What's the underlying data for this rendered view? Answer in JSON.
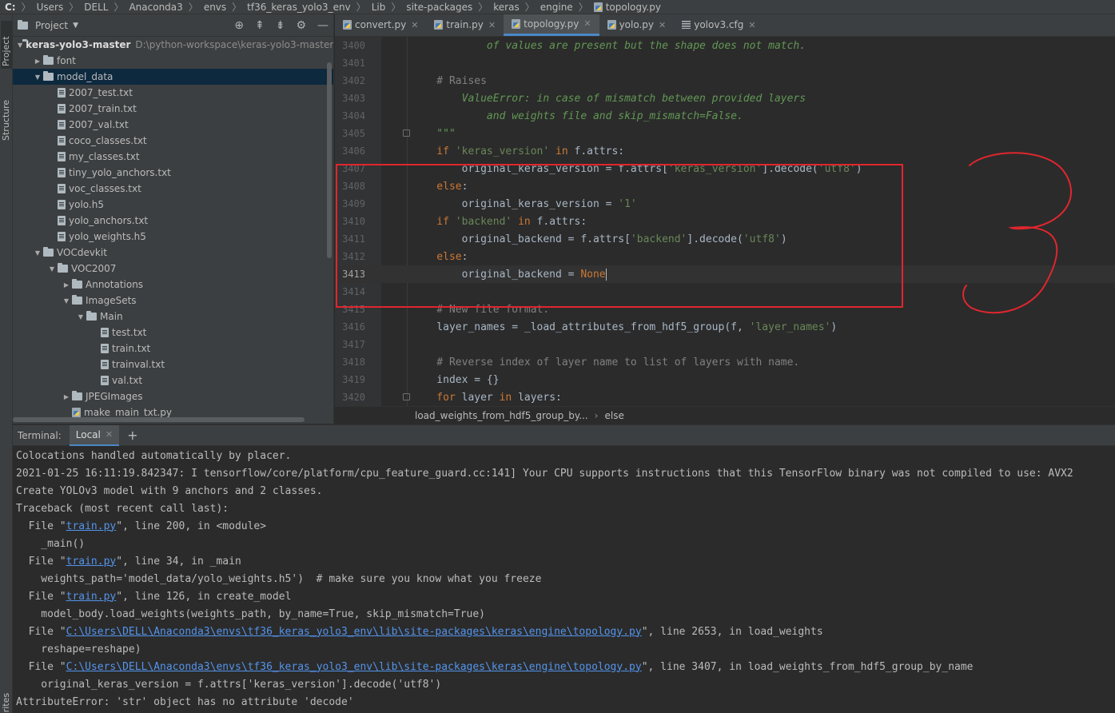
{
  "breadcrumb": [
    "C:",
    "Users",
    "DELL",
    "Anaconda3",
    "envs",
    "tf36_keras_yolo3_env",
    "Lib",
    "site-packages",
    "keras",
    "engine",
    "topology.py"
  ],
  "left_stripe": {
    "project": "Project",
    "structure": "Structure",
    "favorites": "orites"
  },
  "project": {
    "title": "Project",
    "tree": [
      {
        "label": "keras-yolo3-master",
        "path": "D:\\python-workspace\\keras-yolo3-master",
        "depth": 0,
        "arrow": "down",
        "icon": "folder",
        "bold": true
      },
      {
        "label": "font",
        "depth": 1,
        "arrow": "right",
        "icon": "folder"
      },
      {
        "label": "model_data",
        "depth": 1,
        "arrow": "down",
        "icon": "folder",
        "selected": true
      },
      {
        "label": "2007_test.txt",
        "depth": 2,
        "arrow": "none",
        "icon": "txt"
      },
      {
        "label": "2007_train.txt",
        "depth": 2,
        "arrow": "none",
        "icon": "txt"
      },
      {
        "label": "2007_val.txt",
        "depth": 2,
        "arrow": "none",
        "icon": "txt"
      },
      {
        "label": "coco_classes.txt",
        "depth": 2,
        "arrow": "none",
        "icon": "txt"
      },
      {
        "label": "my_classes.txt",
        "depth": 2,
        "arrow": "none",
        "icon": "txt"
      },
      {
        "label": "tiny_yolo_anchors.txt",
        "depth": 2,
        "arrow": "none",
        "icon": "txt"
      },
      {
        "label": "voc_classes.txt",
        "depth": 2,
        "arrow": "none",
        "icon": "txt"
      },
      {
        "label": "yolo.h5",
        "depth": 2,
        "arrow": "none",
        "icon": "txt"
      },
      {
        "label": "yolo_anchors.txt",
        "depth": 2,
        "arrow": "none",
        "icon": "txt"
      },
      {
        "label": "yolo_weights.h5",
        "depth": 2,
        "arrow": "none",
        "icon": "txt"
      },
      {
        "label": "VOCdevkit",
        "depth": 1,
        "arrow": "down",
        "icon": "folder"
      },
      {
        "label": "VOC2007",
        "depth": 2,
        "arrow": "down",
        "icon": "folder"
      },
      {
        "label": "Annotations",
        "depth": 3,
        "arrow": "right",
        "icon": "folder"
      },
      {
        "label": "ImageSets",
        "depth": 3,
        "arrow": "down",
        "icon": "folder"
      },
      {
        "label": "Main",
        "depth": 4,
        "arrow": "down",
        "icon": "folder"
      },
      {
        "label": "test.txt",
        "depth": 5,
        "arrow": "none",
        "icon": "txt"
      },
      {
        "label": "train.txt",
        "depth": 5,
        "arrow": "none",
        "icon": "txt"
      },
      {
        "label": "trainval.txt",
        "depth": 5,
        "arrow": "none",
        "icon": "txt"
      },
      {
        "label": "val.txt",
        "depth": 5,
        "arrow": "none",
        "icon": "txt"
      },
      {
        "label": "JPEGImages",
        "depth": 3,
        "arrow": "right",
        "icon": "folder"
      },
      {
        "label": "make_main_txt.py",
        "depth": 3,
        "arrow": "none",
        "icon": "py"
      }
    ]
  },
  "editor": {
    "tabs": [
      {
        "label": "convert.py",
        "icon": "py",
        "active": false
      },
      {
        "label": "train.py",
        "icon": "py",
        "active": false
      },
      {
        "label": "topology.py",
        "icon": "py",
        "active": true
      },
      {
        "label": "yolo.py",
        "icon": "py",
        "active": false
      },
      {
        "label": "yolov3.cfg",
        "icon": "cfg",
        "active": false
      }
    ],
    "lines": [
      {
        "n": "3400",
        "segs": [
          [
            "doc",
            "            of values are present but the shape does not match."
          ]
        ]
      },
      {
        "n": "3401",
        "segs": []
      },
      {
        "n": "3402",
        "segs": [
          [
            "cmt",
            "    # Raises"
          ]
        ]
      },
      {
        "n": "3403",
        "segs": [
          [
            "doc",
            "        ValueError: in case of mismatch between provided layers"
          ]
        ]
      },
      {
        "n": "3404",
        "segs": [
          [
            "doc",
            "            and weights file and skip_mismatch=False."
          ]
        ]
      },
      {
        "n": "3405",
        "segs": [
          [
            "doc",
            "    \"\"\""
          ]
        ]
      },
      {
        "n": "3406",
        "segs": [
          [
            "kw",
            "    if "
          ],
          [
            "str",
            "'keras_version'"
          ],
          [
            "kw",
            " in "
          ],
          [
            "plain",
            "f.attrs:"
          ]
        ]
      },
      {
        "n": "3407",
        "segs": [
          [
            "plain",
            "        original_keras_version = f.attrs["
          ],
          [
            "str",
            "'keras_version'"
          ],
          [
            "plain",
            "].decode("
          ],
          [
            "str",
            "'utf8'"
          ],
          [
            "plain",
            ")"
          ]
        ]
      },
      {
        "n": "3408",
        "segs": [
          [
            "kw",
            "    else"
          ],
          [
            "plain",
            ":"
          ]
        ]
      },
      {
        "n": "3409",
        "segs": [
          [
            "plain",
            "        original_keras_version = "
          ],
          [
            "str",
            "'1'"
          ]
        ]
      },
      {
        "n": "3410",
        "segs": [
          [
            "kw",
            "    if "
          ],
          [
            "str",
            "'backend'"
          ],
          [
            "kw",
            " in "
          ],
          [
            "plain",
            "f.attrs:"
          ]
        ]
      },
      {
        "n": "3411",
        "segs": [
          [
            "plain",
            "        original_backend = f.attrs["
          ],
          [
            "str",
            "'backend'"
          ],
          [
            "plain",
            "].decode("
          ],
          [
            "str",
            "'utf8'"
          ],
          [
            "plain",
            ")"
          ]
        ]
      },
      {
        "n": "3412",
        "segs": [
          [
            "kw",
            "    else"
          ],
          [
            "plain",
            ":"
          ]
        ]
      },
      {
        "n": "3413",
        "segs": [
          [
            "plain",
            "        original_backend = "
          ],
          [
            "kw",
            "None"
          ]
        ],
        "current": true
      },
      {
        "n": "3414",
        "segs": []
      },
      {
        "n": "3415",
        "segs": [
          [
            "cmt",
            "    # New file format."
          ]
        ]
      },
      {
        "n": "3416",
        "segs": [
          [
            "plain",
            "    layer_names = _load_attributes_from_hdf5_group(f, "
          ],
          [
            "str",
            "'layer_names'"
          ],
          [
            "plain",
            ")"
          ]
        ]
      },
      {
        "n": "3417",
        "segs": []
      },
      {
        "n": "3418",
        "segs": [
          [
            "cmt",
            "    # Reverse index of layer name to list of layers with name."
          ]
        ]
      },
      {
        "n": "3419",
        "segs": [
          [
            "plain",
            "    index = {}"
          ]
        ]
      },
      {
        "n": "3420",
        "segs": [
          [
            "kw",
            "    for "
          ],
          [
            "plain",
            "layer "
          ],
          [
            "kw",
            "in "
          ],
          [
            "plain",
            "layers:"
          ]
        ]
      }
    ],
    "breadcrumb": [
      "load_weights_from_hdf5_group_by...",
      "else"
    ]
  },
  "annotation": {
    "digit": "3",
    "color": "#e0262e"
  },
  "terminal": {
    "label": "Terminal:",
    "tab": "Local",
    "add": "+",
    "lines": [
      [
        [
          "plain",
          "Colocations handled automatically by placer."
        ]
      ],
      [
        [
          "plain",
          "2021-01-25 16:11:19.842347: I tensorflow/core/platform/cpu_feature_guard.cc:141] Your CPU supports instructions that this TensorFlow binary was not compiled to use: AVX2"
        ]
      ],
      [
        [
          "plain",
          "Create YOLOv3 model with 9 anchors and 2 classes."
        ]
      ],
      [
        [
          "plain",
          "Traceback (most recent call last):"
        ]
      ],
      [
        [
          "plain",
          "  File \""
        ],
        [
          "link",
          "train.py"
        ],
        [
          "plain",
          "\", line 200, in <module>"
        ]
      ],
      [
        [
          "plain",
          "    _main()"
        ]
      ],
      [
        [
          "plain",
          "  File \""
        ],
        [
          "link",
          "train.py"
        ],
        [
          "plain",
          "\", line 34, in _main"
        ]
      ],
      [
        [
          "plain",
          "    weights_path='model_data/yolo_weights.h5')  # make sure you know what you freeze"
        ]
      ],
      [
        [
          "plain",
          "  File \""
        ],
        [
          "link",
          "train.py"
        ],
        [
          "plain",
          "\", line 126, in create_model"
        ]
      ],
      [
        [
          "plain",
          "    model_body.load_weights(weights_path, by_name=True, skip_mismatch=True)"
        ]
      ],
      [
        [
          "plain",
          "  File \""
        ],
        [
          "link",
          "C:\\Users\\DELL\\Anaconda3\\envs\\tf36_keras_yolo3_env\\lib\\site-packages\\keras\\engine\\topology.py"
        ],
        [
          "plain",
          "\", line 2653, in load_weights"
        ]
      ],
      [
        [
          "plain",
          "    reshape=reshape)"
        ]
      ],
      [
        [
          "plain",
          "  File \""
        ],
        [
          "link",
          "C:\\Users\\DELL\\Anaconda3\\envs\\tf36_keras_yolo3_env\\lib\\site-packages\\keras\\engine\\topology.py"
        ],
        [
          "plain",
          "\", line 3407, in load_weights_from_hdf5_group_by_name"
        ]
      ],
      [
        [
          "plain",
          "    original_keras_version = f.attrs['keras_version'].decode('utf8')"
        ]
      ],
      [
        [
          "plain",
          "AttributeError: 'str' object has no attribute 'decode'"
        ]
      ]
    ]
  }
}
